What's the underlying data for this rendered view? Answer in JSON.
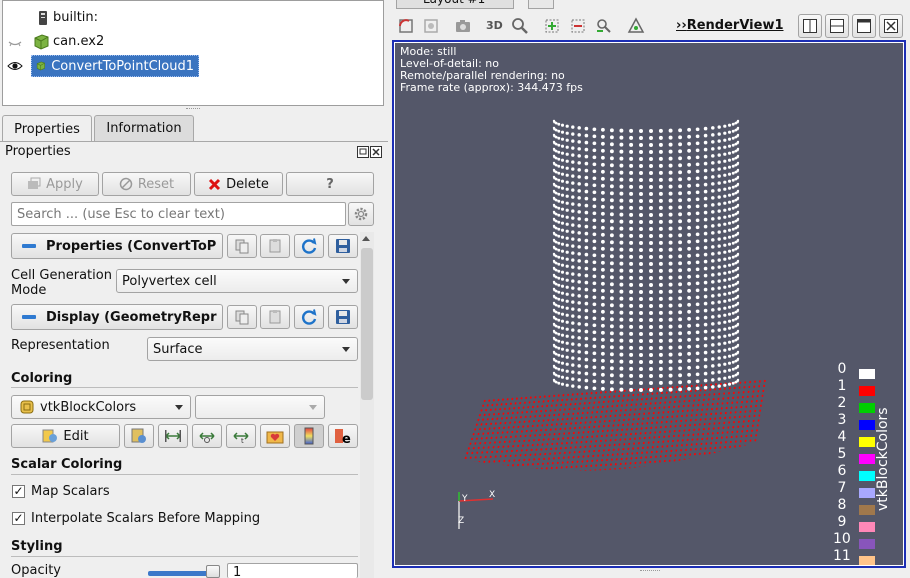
{
  "pipeline": {
    "items": [
      {
        "label": "builtin:"
      },
      {
        "label": "can.ex2"
      },
      {
        "label": "ConvertToPointCloud1"
      }
    ]
  },
  "tabs": [
    {
      "label": "Properties"
    },
    {
      "label": "Information"
    }
  ],
  "properties_panel": {
    "title": "Properties",
    "apply_label": "Apply",
    "reset_label": "Reset",
    "delete_label": "Delete",
    "help_label": "?",
    "search_placeholder": "Search ... (use Esc to clear text)",
    "group_properties": "Properties (ConvertToP",
    "cell_generation_label_1": "Cell Generation",
    "cell_generation_label_2": "Mode",
    "cell_generation_value": "Polyvertex cell",
    "group_display": "Display (GeometryRepr",
    "representation_label": "Representation",
    "representation_value": "Surface",
    "coloring_title": "Coloring",
    "coloring_value": "vtkBlockColors",
    "edit_label": "Edit",
    "scalar_coloring_title": "Scalar Coloring",
    "map_scalars_label": "Map Scalars",
    "interpolate_label": "Interpolate Scalars Before Mapping",
    "styling_title": "Styling",
    "opacity_label": "Opacity",
    "opacity_value": "1"
  },
  "layout_tab": {
    "label": "Layout #1",
    "add_label": "+"
  },
  "render_view": {
    "toolbar_3d_label": "3D",
    "title_prefix": "››",
    "title": "RenderView1",
    "overlay": [
      "Mode: still",
      "Level-of-detail: no",
      "Remote/parallel rendering: no",
      "Frame rate (approx): 344.473 fps"
    ],
    "legend_title": "vtkBlockColors",
    "legend_entries": [
      {
        "label": "0",
        "color": "#ffffff"
      },
      {
        "label": "1",
        "color": "#ff0000"
      },
      {
        "label": "2",
        "color": "#00d000"
      },
      {
        "label": "3",
        "color": "#0000ff"
      },
      {
        "label": "4",
        "color": "#ffff00"
      },
      {
        "label": "5",
        "color": "#ff00ff"
      },
      {
        "label": "6",
        "color": "#00ffff"
      },
      {
        "label": "7",
        "color": "#a8a8ff"
      },
      {
        "label": "8",
        "color": "#a0784c"
      },
      {
        "label": "9",
        "color": "#ff88b8"
      },
      {
        "label": "10",
        "color": "#8855bb"
      },
      {
        "label": "11",
        "color": "#ffc48a"
      }
    ],
    "axes": {
      "y": "Y",
      "x": "X",
      "z": "Z"
    },
    "background": "#545769"
  }
}
